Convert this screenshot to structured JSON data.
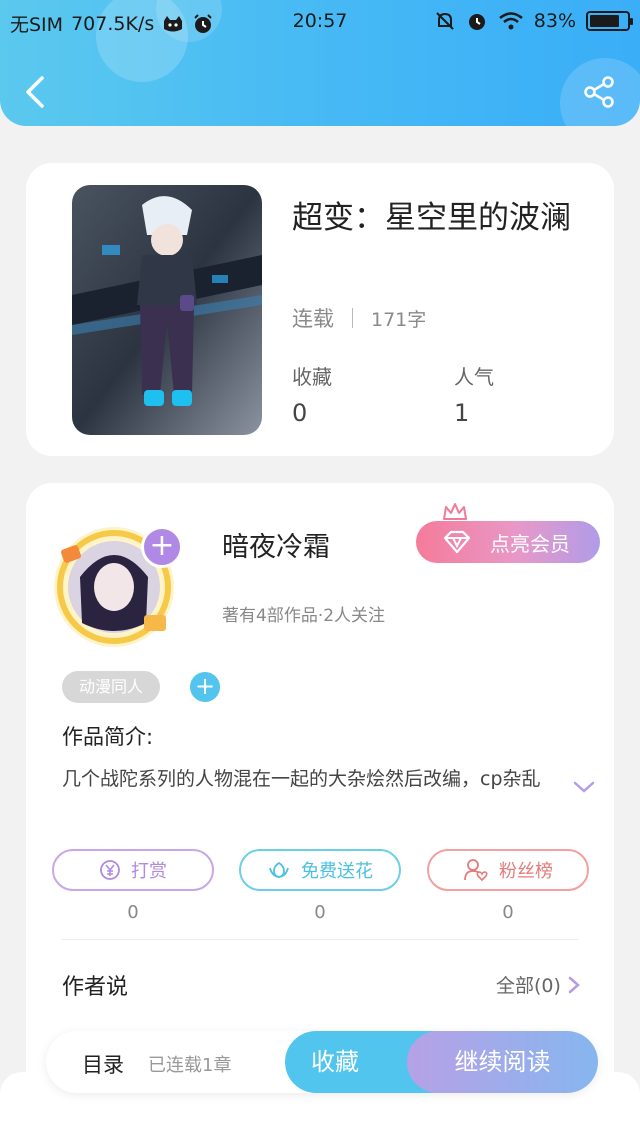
{
  "status_bar": {
    "carrier": "无SIM",
    "speed": "707.5K/s",
    "time": "20:57",
    "battery": "83%",
    "battery_level": 0.83
  },
  "book": {
    "title": "超变：星空里的波澜",
    "status": "连载",
    "word_count": "171字",
    "favorites_label": "收藏",
    "favorites_value": "0",
    "popularity_label": "人气",
    "popularity_value": "1"
  },
  "author": {
    "name": "暗夜冷霜",
    "meta": "著有4部作品·2人关注",
    "vip_button": "点亮会员",
    "tag": "动漫同人"
  },
  "intro": {
    "title": "作品简介:",
    "text": "几个战陀系列的人物混在一起的大杂烩然后改编，cp杂乱"
  },
  "actions": [
    {
      "label": "打赏",
      "value": "0",
      "icon": "yen-coin-icon"
    },
    {
      "label": "免费送花",
      "value": "0",
      "icon": "flower-icon"
    },
    {
      "label": "粉丝榜",
      "value": "0",
      "icon": "fan-heart-icon"
    }
  ],
  "author_say": {
    "title": "作者说",
    "all_link": "全部(0)"
  },
  "bottom": {
    "toc": "目录",
    "chapters": "已连载1章",
    "favorite": "收藏",
    "continue": "继续阅读"
  },
  "colors": {
    "header": "#45b8f5",
    "accent_blue": "#52c5ee",
    "accent_purple": "#b088e6",
    "vip_pink": "#f57b9a"
  }
}
